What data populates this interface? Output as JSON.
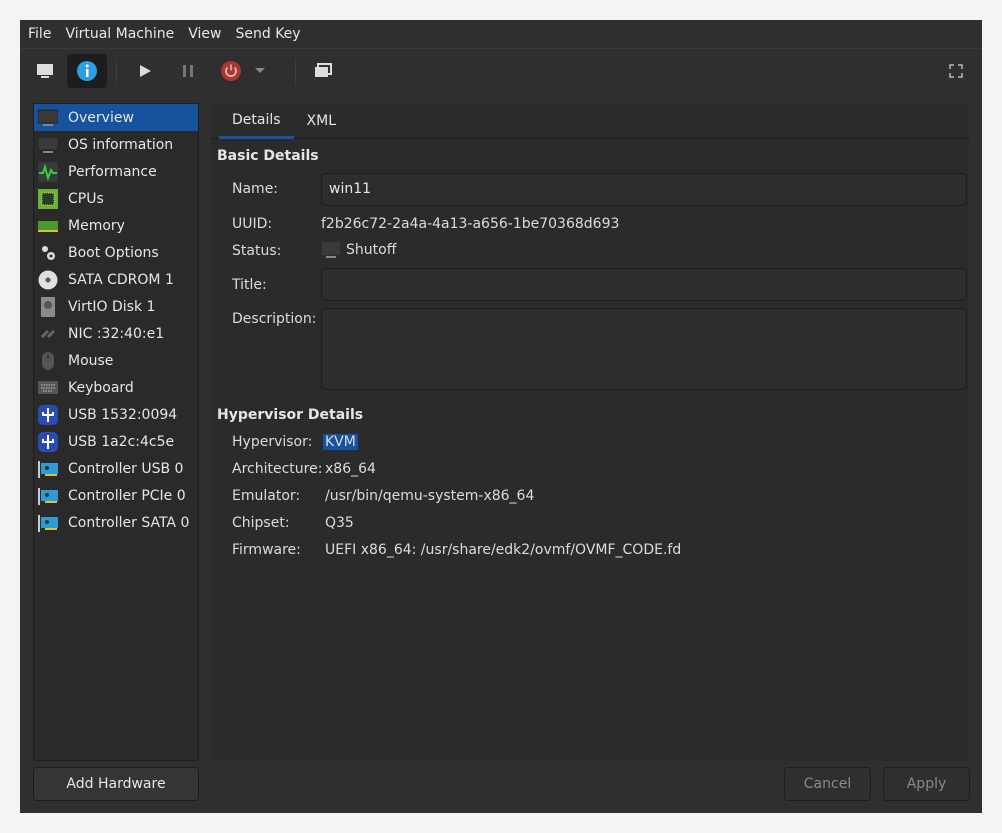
{
  "menu": [
    "File",
    "Virtual Machine",
    "View",
    "Send Key"
  ],
  "toolbar": {
    "icons": [
      "console-icon",
      "info-icon",
      "play-icon",
      "pause-icon",
      "power-icon",
      "dropdown-icon",
      "snapshot-icon",
      "fullscreen-icon"
    ]
  },
  "sidebar": {
    "items": [
      {
        "label": "Overview",
        "icon": "monitor-icon"
      },
      {
        "label": "OS information",
        "icon": "monitor-icon"
      },
      {
        "label": "Performance",
        "icon": "performance-icon"
      },
      {
        "label": "CPUs",
        "icon": "cpu-icon"
      },
      {
        "label": "Memory",
        "icon": "memory-icon"
      },
      {
        "label": "Boot Options",
        "icon": "gears-icon"
      },
      {
        "label": "SATA CDROM 1",
        "icon": "cdrom-icon"
      },
      {
        "label": "VirtIO Disk 1",
        "icon": "disk-icon"
      },
      {
        "label": "NIC :32:40:e1",
        "icon": "network-icon"
      },
      {
        "label": "Mouse",
        "icon": "mouse-icon"
      },
      {
        "label": "Keyboard",
        "icon": "keyboard-icon"
      },
      {
        "label": "USB 1532:0094",
        "icon": "usb-icon"
      },
      {
        "label": "USB 1a2c:4c5e",
        "icon": "usb-icon"
      },
      {
        "label": "Controller USB 0",
        "icon": "controller-icon"
      },
      {
        "label": "Controller PCIe 0",
        "icon": "controller-icon"
      },
      {
        "label": "Controller SATA 0",
        "icon": "controller-icon"
      }
    ]
  },
  "tabs": [
    "Details",
    "XML"
  ],
  "basic": {
    "heading": "Basic Details",
    "name_label": "Name:",
    "name": "win11",
    "uuid_label": "UUID:",
    "uuid": "f2b26c72-2a4a-4a13-a656-1be70368d693",
    "status_label": "Status:",
    "status": "Shutoff",
    "title_label": "Title:",
    "title": "",
    "desc_label": "Description:",
    "desc": ""
  },
  "hyper": {
    "heading": "Hypervisor Details",
    "rows": [
      {
        "label": "Hypervisor:",
        "value": "KVM"
      },
      {
        "label": "Architecture:",
        "value": "x86_64"
      },
      {
        "label": "Emulator:",
        "value": "/usr/bin/qemu-system-x86_64"
      },
      {
        "label": "Chipset:",
        "value": "Q35"
      },
      {
        "label": "Firmware:",
        "value": "UEFI x86_64: /usr/share/edk2/ovmf/OVMF_CODE.fd"
      }
    ]
  },
  "buttons": {
    "add": "Add Hardware",
    "cancel": "Cancel",
    "apply": "Apply"
  },
  "colors": {
    "accent": "#15539e",
    "info": "#2d9fe0",
    "power": "#a53a33"
  }
}
